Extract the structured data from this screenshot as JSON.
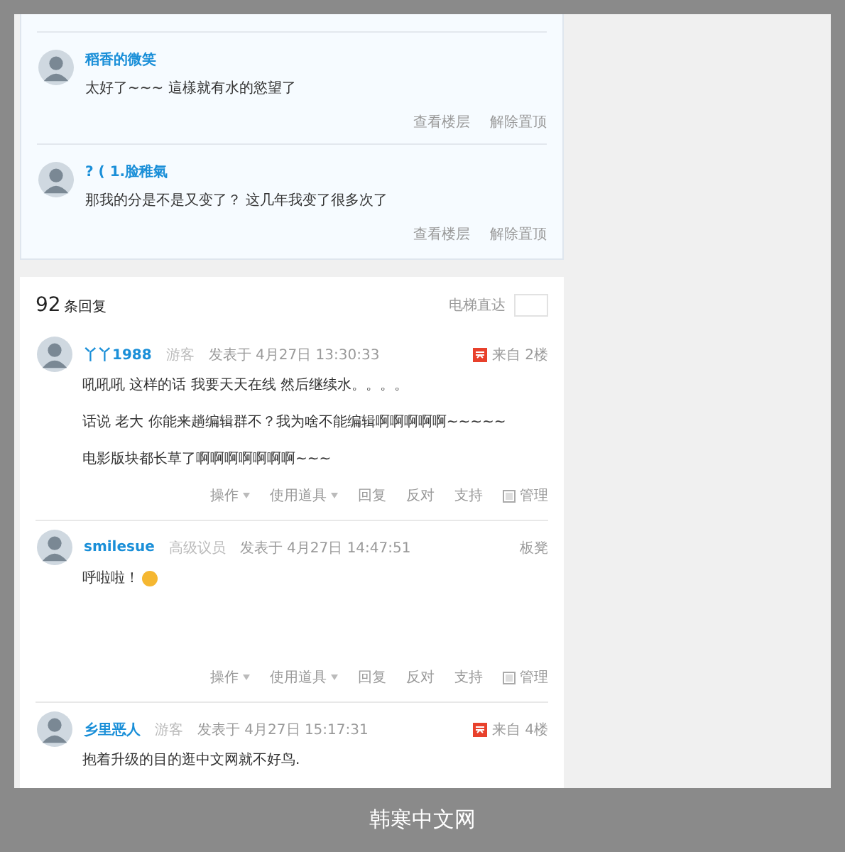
{
  "pinned_replies": [
    {
      "author": "稻香的微笑",
      "text": "太好了~~~ 這樣就有水的慾望了",
      "actions": [
        "查看楼层",
        "解除置顶"
      ]
    },
    {
      "author": "? ( 1.脸稚氣",
      "text": "那我的分是不是又变了？ 这几年我变了很多次了",
      "actions": [
        "查看楼层",
        "解除置顶"
      ]
    }
  ],
  "replies_header": {
    "count": "92",
    "label": "条回复",
    "jump_label": "电梯直达"
  },
  "posts": [
    {
      "author": "丫丫1988",
      "role": "游客",
      "posted": "发表于 4月27日 13:30:33",
      "floor": {
        "kind": "from",
        "text": "来自 2楼"
      },
      "body": [
        {
          "text": "吼吼吼 这样的话 我要天天在线 然后继续水。。。。",
          "emoji": false
        },
        {
          "text": "话说 老大 你能来趟编辑群不？我为啥不能编辑啊啊啊啊啊~~~~~",
          "emoji": false
        },
        {
          "text": "电影版块都长草了啊啊啊啊啊啊啊~~~",
          "emoji": false
        }
      ],
      "actions": [
        {
          "label": "操作",
          "kind": "menu"
        },
        {
          "label": "使用道具",
          "kind": "menu"
        },
        {
          "label": "回复",
          "kind": "link"
        },
        {
          "label": "反对",
          "kind": "link"
        },
        {
          "label": "支持",
          "kind": "link"
        },
        {
          "label": "管理",
          "kind": "icon"
        }
      ]
    },
    {
      "author": "smilesue",
      "role": "高级议员",
      "posted": "发表于 4月27日 14:47:51",
      "floor": {
        "kind": "plain",
        "text": "板凳"
      },
      "body": [
        {
          "text": "呼啦啦！",
          "emoji": true
        }
      ],
      "actions": [
        {
          "label": "操作",
          "kind": "menu"
        },
        {
          "label": "使用道具",
          "kind": "menu"
        },
        {
          "label": "回复",
          "kind": "link"
        },
        {
          "label": "反对",
          "kind": "link"
        },
        {
          "label": "支持",
          "kind": "link"
        },
        {
          "label": "管理",
          "kind": "icon"
        }
      ]
    },
    {
      "author": "乡里恶人",
      "role": "游客",
      "posted": "发表于 4月27日 15:17:31",
      "floor": {
        "kind": "from",
        "text": "来自 4楼"
      },
      "body": [
        {
          "text": "抱着升级的目的逛中文网就不好鸟.",
          "emoji": false
        }
      ]
    }
  ],
  "caption": "韩寒中文网"
}
